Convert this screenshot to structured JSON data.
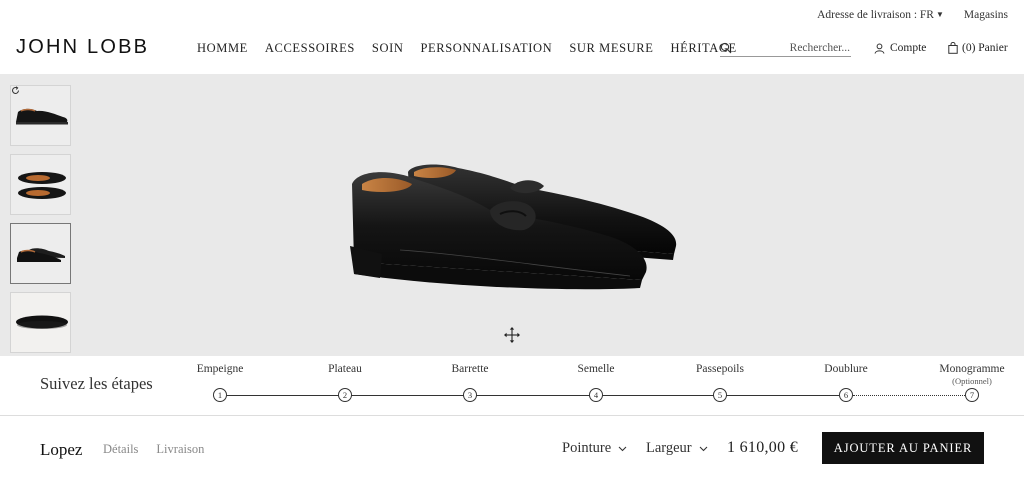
{
  "utility": {
    "delivery_label": "Adresse de livraison : FR",
    "stores_label": "Magasins"
  },
  "header": {
    "logo": "JOHN LOBB",
    "nav": [
      "HOMME",
      "ACCESSOIRES",
      "SOIN",
      "PERSONNALISATION",
      "SUR MESURE",
      "HÉRITAGE"
    ],
    "search_placeholder": "Rechercher...",
    "account_label": "Compte",
    "cart_label": "(0) Panier"
  },
  "steps": {
    "title": "Suivez les étapes",
    "items": [
      {
        "label": "Empeigne",
        "number": "1",
        "sub": ""
      },
      {
        "label": "Plateau",
        "number": "2",
        "sub": ""
      },
      {
        "label": "Barrette",
        "number": "3",
        "sub": ""
      },
      {
        "label": "Semelle",
        "number": "4",
        "sub": ""
      },
      {
        "label": "Passepoils",
        "number": "5",
        "sub": ""
      },
      {
        "label": "Doublure",
        "number": "6",
        "sub": ""
      },
      {
        "label": "Monogramme",
        "number": "7",
        "sub": "(Optionnel)"
      }
    ]
  },
  "product": {
    "name": "Lopez",
    "details_label": "Détails",
    "delivery_label": "Livraison",
    "size_label": "Pointure",
    "width_label": "Largeur",
    "price": "1 610,00 €",
    "add_to_cart_label": "AJOUTER AU PANIER"
  },
  "icons": {
    "search": "search-icon",
    "account": "user-icon",
    "cart": "shopping-bag-icon",
    "rotate": "rotate-icon",
    "move": "move-arrows-icon"
  },
  "colors": {
    "viewer_bg": "#e9e9e9",
    "button_bg": "#111111"
  }
}
